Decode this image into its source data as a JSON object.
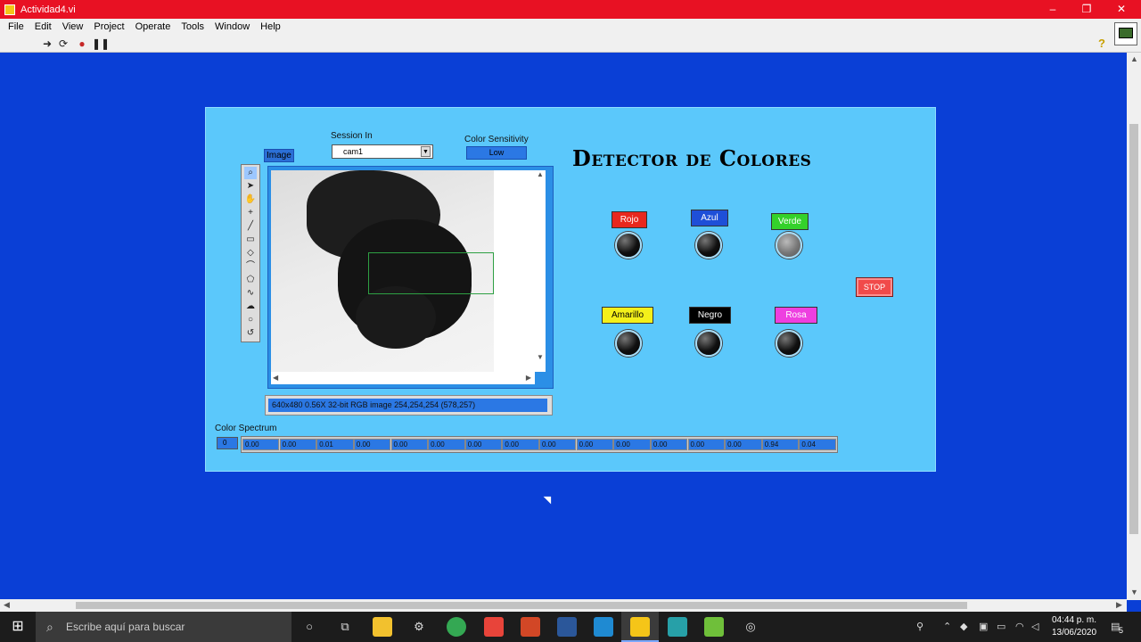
{
  "window": {
    "title": "Actividad4.vi",
    "minimize": "–",
    "restore": "❐",
    "close": "✕"
  },
  "menu": [
    "File",
    "Edit",
    "View",
    "Project",
    "Operate",
    "Tools",
    "Window",
    "Help"
  ],
  "panel": {
    "title": "Detector de Colores",
    "image_label": "Image",
    "session": {
      "label": "Session In",
      "value": "cam1"
    },
    "sensitivity": {
      "label": "Color Sensitivity",
      "value": "Low"
    },
    "image_status": "640x480 0.56X 32-bit RGB image 254,254,254     (578,257)",
    "spectrum": {
      "label": "Color Spectrum",
      "index": "0",
      "values": [
        "0.00",
        "0.00",
        "0.01",
        "0.00",
        "0.00",
        "0.00",
        "0.00",
        "0.00",
        "0.00",
        "0.00",
        "0.00",
        "0.00",
        "0.00",
        "0.00",
        "0.94",
        "0.04"
      ]
    },
    "indicators": [
      {
        "label": "Rojo",
        "color": "#e8281e",
        "text_color": "#ffffff",
        "on": false
      },
      {
        "label": "Azul",
        "color": "#1e4fd8",
        "text_color": "#ffffff",
        "on": false
      },
      {
        "label": "Verde",
        "color": "#34d12a",
        "text_color": "#ffffff",
        "on": true
      },
      {
        "label": "Amarillo",
        "color": "#f4f01a",
        "text_color": "#000000",
        "on": false
      },
      {
        "label": "Negro",
        "color": "#000000",
        "text_color": "#ffffff",
        "on": false
      },
      {
        "label": "Rosa",
        "color": "#ee3fe0",
        "text_color": "#ffffff",
        "on": false
      }
    ],
    "stop_label": "STOP"
  },
  "taskbar": {
    "search_placeholder": "Escribe aquí para buscar",
    "time": "04:44 p. m.",
    "date": "13/06/2020",
    "notifications": "5"
  }
}
